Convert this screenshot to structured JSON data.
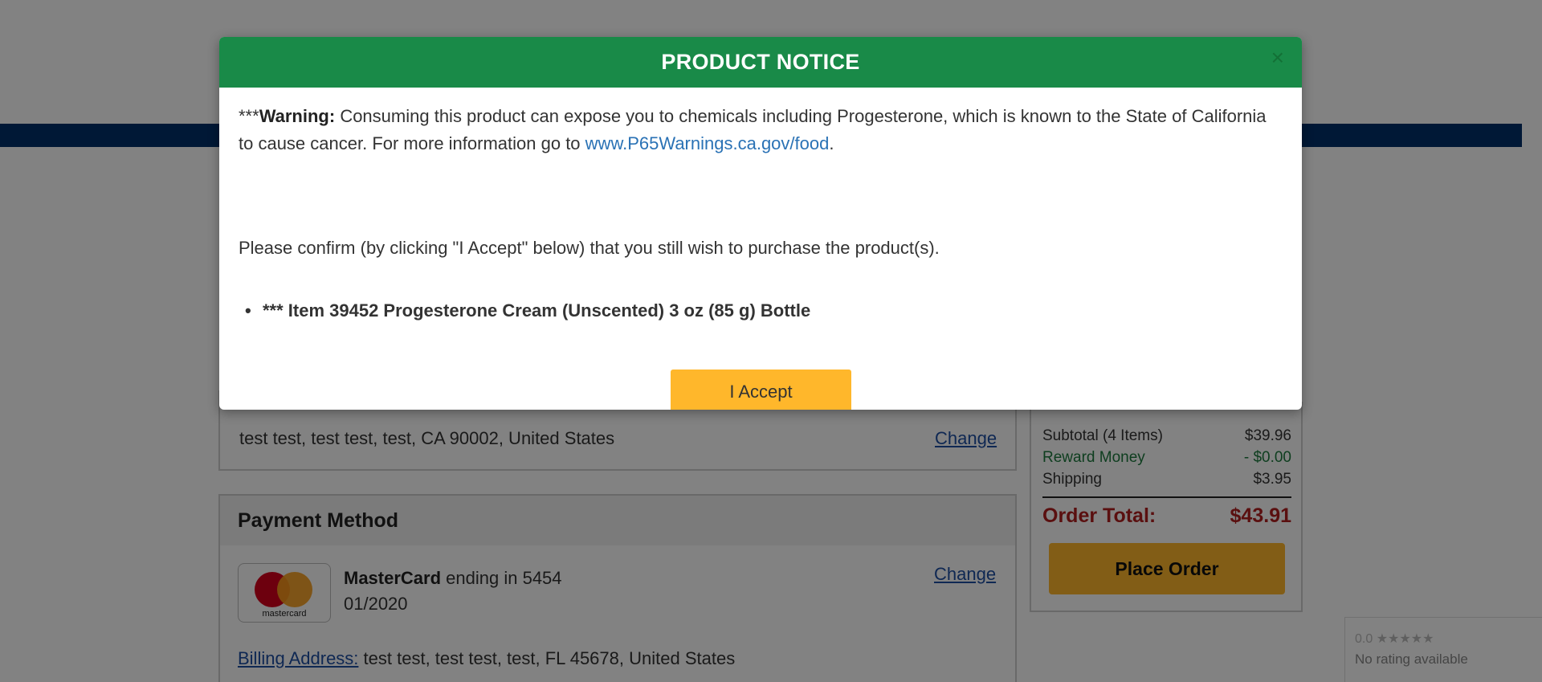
{
  "shipping": {
    "address": "test test, test test, test, CA 90002, United States",
    "change_label": "Change"
  },
  "payment": {
    "title": "Payment Method",
    "card_brand_logo_text": "mastercard",
    "card_brand": "MasterCard",
    "card_ending_text": "ending in 5454",
    "card_expiry": "01/2020",
    "change_label": "Change",
    "billing_label": "Billing Address:",
    "billing_address": "test test, test test, test, FL 45678, United States"
  },
  "summary": {
    "subtotal_label": "Subtotal (4 Items)",
    "subtotal_value": "$39.96",
    "reward_label": "Reward Money",
    "reward_value": "- $0.00",
    "shipping_label": "Shipping",
    "shipping_value": "$3.95",
    "total_label": "Order Total:",
    "total_value": "$43.91",
    "place_order_label": "Place Order"
  },
  "rating_widget": {
    "score": "0.0",
    "stars": "★★★★★",
    "text": "No rating available"
  },
  "modal": {
    "title": "PRODUCT NOTICE",
    "close_icon": "×",
    "warning_prefix": "***",
    "warning_label": "Warning:",
    "warning_text": "Consuming this product can expose you to chemicals including Progesterone, which is known to the State of California to cause cancer. For more information go to",
    "warning_link": "www.P65Warnings.ca.gov/food",
    "warning_end": ".",
    "confirm_text": "Please confirm (by clicking \"I Accept\" below) that you still wish to purchase the product(s).",
    "items": [
      "*** Item 39452 Progesterone Cream (Unscented) 3 oz (85 g) Bottle"
    ],
    "accept_label": "I Accept"
  },
  "colors": {
    "header_green": "#198a48",
    "accent_yellow": "#ffb72b",
    "nav_blue": "#00306b",
    "total_red": "#b01e1e",
    "reward_green": "#1d7a3e"
  }
}
